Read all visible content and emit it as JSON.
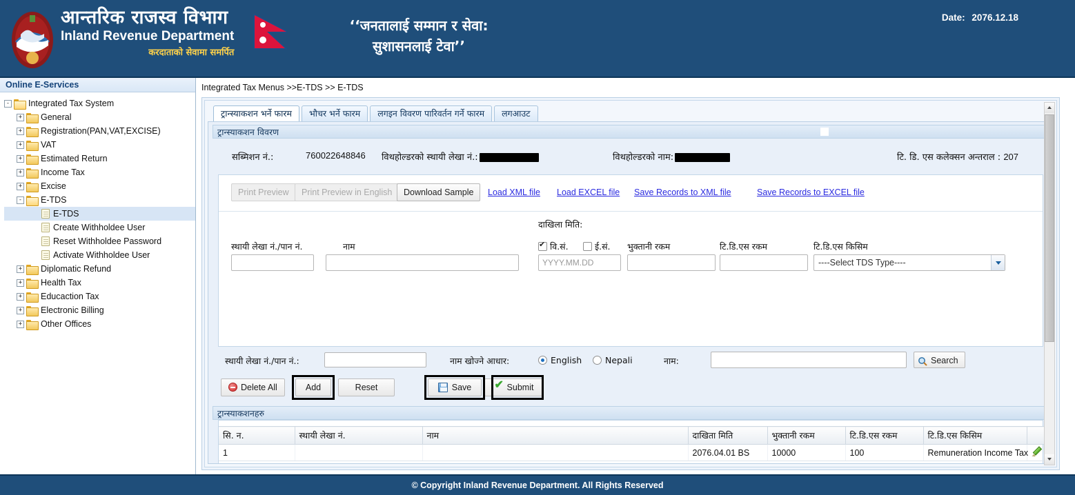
{
  "header": {
    "dept_np": "आन्तरिक राजस्व विभाग",
    "dept_en": "Inland Revenue Department",
    "dept_sub": "करदाताको सेवामा समर्पित",
    "slogan_line1": "‘‘जनतालाई सम्मान र सेवा:",
    "slogan_line2": "सुशासनलाई टेवा’’",
    "date_label": "Date:",
    "date_value": "2076.12.18"
  },
  "sidebar": {
    "title": "Online E-Services",
    "items": [
      {
        "label": "Integrated Tax System",
        "level": 1,
        "kind": "folder-open",
        "expander": "-",
        "selected": false
      },
      {
        "label": "General",
        "level": 2,
        "kind": "folder",
        "expander": "+",
        "selected": false
      },
      {
        "label": "Registration(PAN,VAT,EXCISE)",
        "level": 2,
        "kind": "folder",
        "expander": "+",
        "selected": false
      },
      {
        "label": "VAT",
        "level": 2,
        "kind": "folder",
        "expander": "+",
        "selected": false
      },
      {
        "label": "Estimated Return",
        "level": 2,
        "kind": "folder",
        "expander": "+",
        "selected": false
      },
      {
        "label": "Income Tax",
        "level": 2,
        "kind": "folder",
        "expander": "+",
        "selected": false
      },
      {
        "label": "Excise",
        "level": 2,
        "kind": "folder",
        "expander": "+",
        "selected": false
      },
      {
        "label": "E-TDS",
        "level": 2,
        "kind": "folder-open",
        "expander": "-",
        "selected": false
      },
      {
        "label": "E-TDS",
        "level": 3,
        "kind": "doc",
        "expander": "",
        "selected": true
      },
      {
        "label": "Create Withholdee User",
        "level": 3,
        "kind": "doc",
        "expander": "",
        "selected": false
      },
      {
        "label": "Reset Withholdee Password",
        "level": 3,
        "kind": "doc",
        "expander": "",
        "selected": false
      },
      {
        "label": "Activate Withholdee User",
        "level": 3,
        "kind": "doc",
        "expander": "",
        "selected": false
      },
      {
        "label": "Diplomatic Refund",
        "level": 2,
        "kind": "folder",
        "expander": "+",
        "selected": false
      },
      {
        "label": "Health Tax",
        "level": 2,
        "kind": "folder",
        "expander": "+",
        "selected": false
      },
      {
        "label": "Educaction Tax",
        "level": 2,
        "kind": "folder",
        "expander": "+",
        "selected": false
      },
      {
        "label": "Electronic Billing",
        "level": 2,
        "kind": "folder",
        "expander": "+",
        "selected": false
      },
      {
        "label": "Other Offices",
        "level": 2,
        "kind": "folder",
        "expander": "+",
        "selected": false
      }
    ]
  },
  "main": {
    "breadcrumb": "Integrated Tax Menus >>E-TDS >> E-TDS",
    "tabs": [
      {
        "label": "ट्रान्स्याकशन भर्ने फारम",
        "active": true
      },
      {
        "label": "भौचर भर्ने फारम",
        "active": false
      },
      {
        "label": "लगइन विवरण पारिवर्तन गर्ने फारम",
        "active": false
      },
      {
        "label": "लगआउट",
        "active": false
      }
    ],
    "section_title": "ट्रान्स्याकशन विवरण",
    "info": {
      "submission_label": "सब्मिशन नं.:",
      "submission_value": "760022648846",
      "withholder_pan_label": "विथहोल्डरको स्थायी लेखा नं.:",
      "withholder_pan_value": "",
      "withholder_name_label": "विथहोल्डरको नाम:",
      "withholder_name_value": "",
      "tds_interval_label": "टि. डि. एस कलेक्सन अन्तराल :",
      "tds_interval_value": "207"
    },
    "toolbar": {
      "print_preview": "Print Preview",
      "print_preview_english": "Print Preview in English",
      "download_sample": "Download Sample",
      "load_xml": "Load XML file",
      "load_excel": "Load EXCEL file",
      "save_xml": "Save Records to XML file",
      "save_excel": "Save Records to EXCEL file"
    },
    "form": {
      "pan_label": "स्थायी लेखा नं./पान नं.",
      "pan_value": "",
      "name_label": "नाम",
      "name_value": "",
      "filing_date_label": "दाखिला मिति:",
      "bs_label": "वि.सं.",
      "bs_checked": true,
      "ad_label": "ई.सं.",
      "ad_checked": false,
      "date_placeholder": "YYYY.MM.DD",
      "date_value": "",
      "payment_amount_label": "भुक्तानी रकम",
      "payment_amount_value": "",
      "tds_amount_label": "टि.डि.एस रकम",
      "tds_amount_value": "",
      "tds_type_label": "टि.डि.एस किसिम",
      "tds_type_selected": "----Select TDS Type----"
    },
    "search": {
      "pan_label": "स्थायी लेखा नं./पान नं.:",
      "pan_value": "",
      "basis_label": "नाम खोज्ने आधार:",
      "radio_english": "English",
      "radio_nepali": "Nepali",
      "radio_selected": "English",
      "name_label": "नाम:",
      "name_value": "",
      "search_button": "Search"
    },
    "actions": {
      "delete_all": "Delete All",
      "add": "Add",
      "reset": "Reset",
      "save": "Save",
      "submit": "Submit",
      "highlighted": [
        "Add",
        "Save",
        "Submit"
      ]
    },
    "grid": {
      "title": "ट्रान्स्याकशनहरु",
      "columns": [
        "सि. न.",
        "स्थायी लेखा नं.",
        "नाम",
        "दाखिता मिति",
        "भुक्तानी रकम",
        "टि.डि.एस रकम",
        "टि.डि.एस किसिम",
        "",
        ""
      ],
      "rows": [
        {
          "sn": "1",
          "pan": "",
          "name": "",
          "filing_date": "2076.04.01 BS",
          "payment_amount": "10000",
          "tds_amount": "100",
          "tds_type": "Remuneration Income Tax",
          "edit_icon": "edit-pencil-icon",
          "delete_icon": "delete-circle-icon"
        }
      ]
    }
  },
  "footer": {
    "text": "© Copyright Inland Revenue Department. All Rights Reserved"
  },
  "colors": {
    "header_blue": "#1f4e7a",
    "link_blue": "#2a2ae0",
    "panel_blue": "#e9f0f9",
    "accent_yellow": "#ffd24a"
  }
}
